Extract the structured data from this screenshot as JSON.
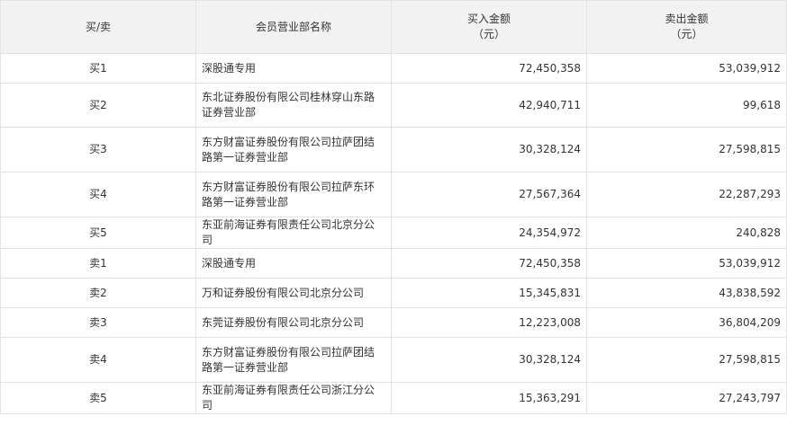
{
  "header": {
    "side": "买/卖",
    "name": "会员营业部名称",
    "buy_line1": "买入金额",
    "buy_line2": "（元）",
    "sell_line1": "卖出金额",
    "sell_line2": "（元）"
  },
  "rows": [
    {
      "side": "买1",
      "name": "深股通专用",
      "buy": "72,450,358",
      "sell": "53,039,912"
    },
    {
      "side": "买2",
      "name": "东北证券股份有限公司桂林穿山东路证券营业部",
      "buy": "42,940,711",
      "sell": "99,618"
    },
    {
      "side": "买3",
      "name": "东方财富证券股份有限公司拉萨团结路第一证券营业部",
      "buy": "30,328,124",
      "sell": "27,598,815"
    },
    {
      "side": "买4",
      "name": "东方财富证券股份有限公司拉萨东环路第一证券营业部",
      "buy": "27,567,364",
      "sell": "22,287,293"
    },
    {
      "side": "买5",
      "name": "东亚前海证券有限责任公司北京分公司",
      "buy": "24,354,972",
      "sell": "240,828"
    },
    {
      "side": "卖1",
      "name": "深股通专用",
      "buy": "72,450,358",
      "sell": "53,039,912"
    },
    {
      "side": "卖2",
      "name": "万和证券股份有限公司北京分公司",
      "buy": "15,345,831",
      "sell": "43,838,592"
    },
    {
      "side": "卖3",
      "name": "东莞证券股份有限公司北京分公司",
      "buy": "12,223,008",
      "sell": "36,804,209"
    },
    {
      "side": "卖4",
      "name": "东方财富证券股份有限公司拉萨团结路第一证券营业部",
      "buy": "30,328,124",
      "sell": "27,598,815"
    },
    {
      "side": "卖5",
      "name": "东亚前海证券有限责任公司浙江分公司",
      "buy": "15,363,291",
      "sell": "27,243,797"
    }
  ]
}
